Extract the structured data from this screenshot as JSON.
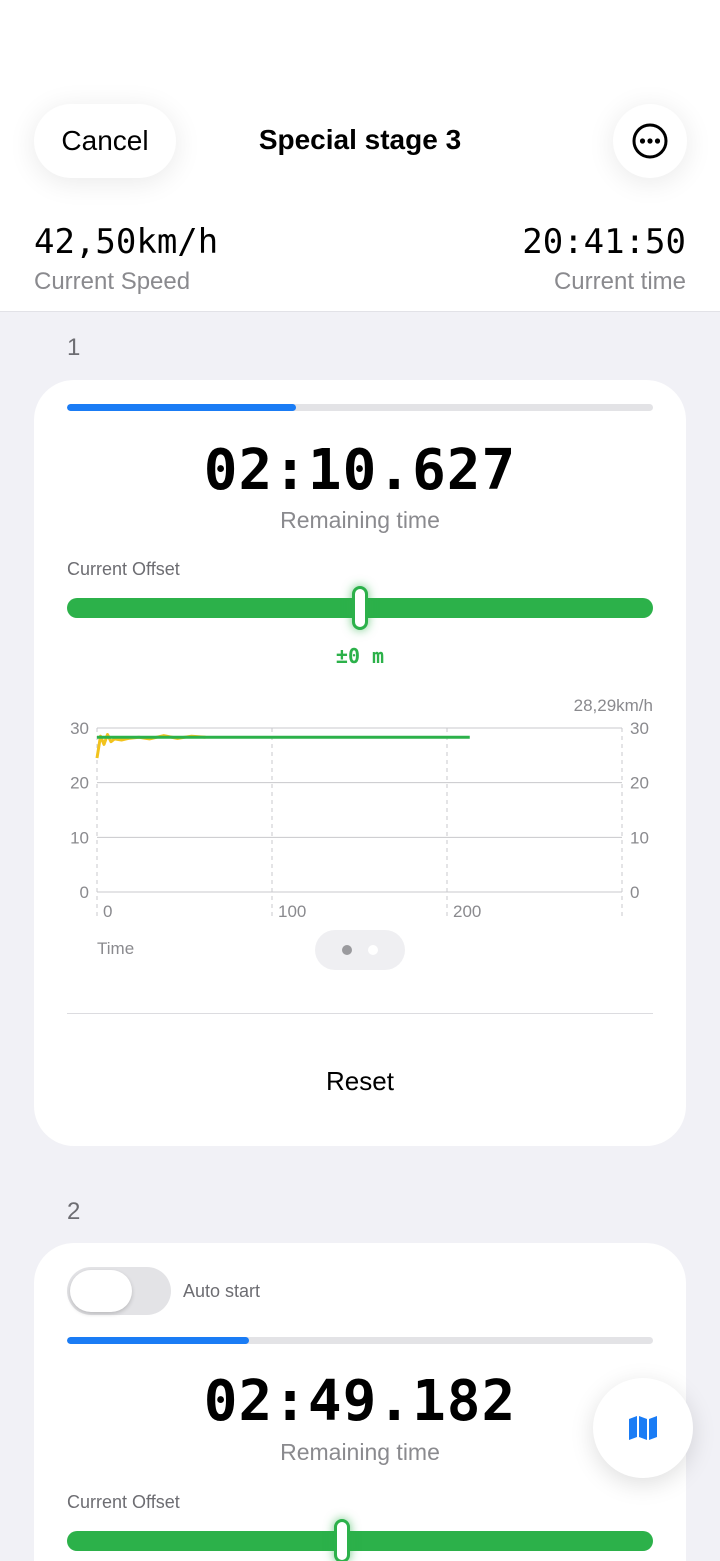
{
  "header": {
    "cancel_label": "Cancel",
    "title": "Special stage 3",
    "more_icon": "ellipsis-circle-icon",
    "speed_value": "42,50km/h",
    "speed_label": "Current Speed",
    "time_value": "20:41:50",
    "time_label": "Current time"
  },
  "colors": {
    "accent_blue": "#1a7cf5",
    "offset_green": "#2cb14a",
    "speed_yellow": "#f2c31c",
    "background": "#f1f1f6"
  },
  "stages": [
    {
      "number": "1",
      "progress": 0.39,
      "remaining_time": "02:10.627",
      "remaining_label": "Remaining time",
      "offset_label": "Current Offset",
      "offset_position": 0.5,
      "offset_value": "±0 m",
      "chart": {
        "speed_readout": "28,29km/h",
        "x_label": "Time",
        "page_dots": 2,
        "active_page": 0
      },
      "reset_label": "Reset"
    },
    {
      "number": "2",
      "auto_start_label": "Auto start",
      "auto_start_on": false,
      "progress": 0.31,
      "remaining_time": "02:49.182",
      "remaining_label": "Remaining time",
      "offset_label": "Current Offset",
      "offset_position": 0.47
    }
  ],
  "fab": {
    "icon": "map-icon"
  },
  "chart_data": {
    "type": "line",
    "xlim": [
      0,
      300
    ],
    "ylim": [
      0,
      30
    ],
    "x_ticks": [
      0,
      100,
      200
    ],
    "y_ticks": [
      0,
      10,
      20,
      30
    ],
    "xlabel": "Time",
    "ylabel": "",
    "grid": true,
    "series": [
      {
        "color": "#2cb14a",
        "x": [
          0,
          213
        ],
        "y": [
          28.3,
          28.3
        ]
      },
      {
        "color": "#f2c31c",
        "x": [
          0,
          2,
          4,
          6,
          8,
          10,
          14,
          18,
          24,
          30,
          38,
          46,
          54,
          62
        ],
        "y": [
          24.5,
          28.5,
          27.0,
          28.8,
          27.5,
          28.0,
          27.8,
          28.1,
          28.3,
          28.0,
          28.6,
          28.1,
          28.5,
          28.3
        ]
      }
    ]
  }
}
